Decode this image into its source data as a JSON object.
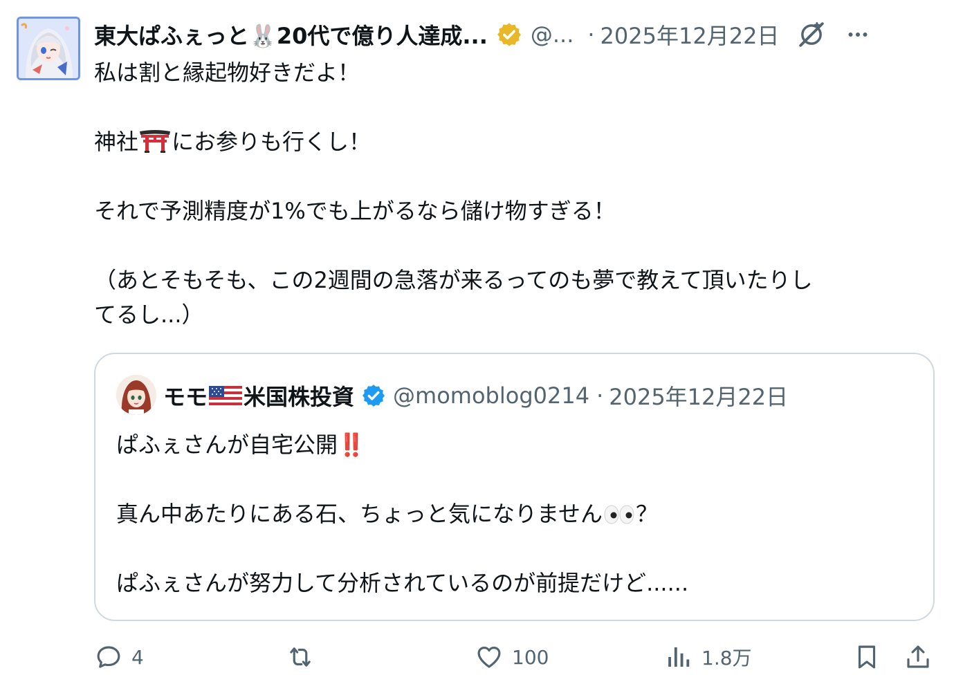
{
  "tweet": {
    "display_name": "東大ぱふぇっと🐰20代で億り人達成...",
    "handle": "@...",
    "dot": "·",
    "date": "2025年12月22日",
    "lines": {
      "l1": "私は割と縁起物好きだよ！",
      "l2_a": "神社",
      "l2_b": "にお参りも行くし！",
      "l3": "それで予測精度が1%でも上がるなら儲け物すぎる！",
      "l4": "（あとそもそも、この2週間の急落が来るってのも夢で教えて頂いたりし",
      "l5": "てるし...）"
    },
    "icons": {
      "verified": "verified-gold-badge-icon",
      "grok": "grok-icon",
      "more": "more-icon",
      "torii": "torii-gate-emoji"
    },
    "colors": {
      "gold_badge": "#e8b829",
      "text": "#0f1419",
      "muted": "#536471"
    }
  },
  "quote": {
    "display_name_a": "モモ",
    "display_name_b": "米国株投資",
    "handle": "@momoblog0214",
    "dot": "·",
    "date": "2025年12月22日",
    "lines": {
      "l1": "ぱふぇさんが自宅公開",
      "l1_emoji": "‼️",
      "l2_a": "真ん中あたりにある石、ちょっと気になりません",
      "l2_b": "？",
      "l3": "ぱふぇさんが努力して分析されているのが前提だけど......"
    },
    "icons": {
      "flag": "us-flag-emoji",
      "verified": "verified-blue-badge-icon",
      "eyes": "eyes-emoji"
    },
    "colors": {
      "blue_badge": "#1d9bf0",
      "border": "#cfd9de"
    }
  },
  "actions": {
    "reply_count": "4",
    "retweet_count": "",
    "like_count": "100",
    "views_count": "1.8万"
  }
}
